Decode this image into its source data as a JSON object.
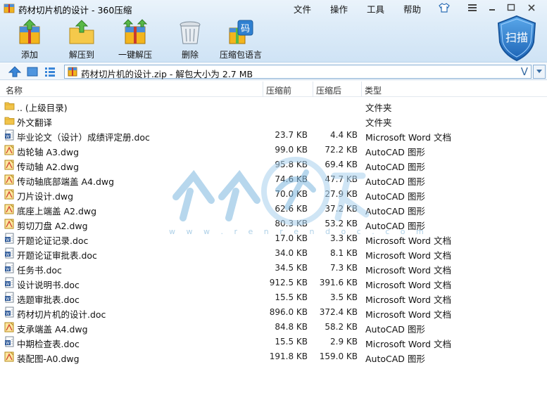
{
  "window": {
    "title": "药材切片机的设计 - 360压缩",
    "menu": [
      "文件",
      "操作",
      "工具",
      "帮助"
    ]
  },
  "toolbar": {
    "add": "添加",
    "extract_to": "解压到",
    "one_click_extract": "一键解压",
    "delete": "删除",
    "encoding": "压缩包语言",
    "scan": "扫描",
    "encoding_icon_char": "码"
  },
  "address": {
    "path": "药材切片机的设计.zip - 解包大小为 2.7 MB",
    "v_char": "V"
  },
  "columns": {
    "name": "名称",
    "compressed_before": "压缩前",
    "compressed_after": "压缩后",
    "type": "类型"
  },
  "files": [
    {
      "name": ".. (上级目录)",
      "before": "",
      "after": "",
      "type": "文件夹",
      "icon": "folder-icon"
    },
    {
      "name": "外文翻译",
      "before": "",
      "after": "",
      "type": "文件夹",
      "icon": "folder-icon"
    },
    {
      "name": "毕业论文（设计）成绩评定册.doc",
      "before": "23.7 KB",
      "after": "4.4 KB",
      "type": "Microsoft Word 文档",
      "icon": "word-doc-icon"
    },
    {
      "name": "齿轮轴 A3.dwg",
      "before": "99.0 KB",
      "after": "72.2 KB",
      "type": "AutoCAD 图形",
      "icon": "autocad-icon"
    },
    {
      "name": "传动轴 A2.dwg",
      "before": "95.8 KB",
      "after": "69.4 KB",
      "type": "AutoCAD 图形",
      "icon": "autocad-icon"
    },
    {
      "name": "传动轴底部端盖 A4.dwg",
      "before": "74.6 KB",
      "after": "47.7 KB",
      "type": "AutoCAD 图形",
      "icon": "autocad-icon"
    },
    {
      "name": "刀片设计.dwg",
      "before": "70.0 KB",
      "after": "27.9 KB",
      "type": "AutoCAD 图形",
      "icon": "autocad-icon"
    },
    {
      "name": "底座上端盖 A2.dwg",
      "before": "62.6 KB",
      "after": "37.2 KB",
      "type": "AutoCAD 图形",
      "icon": "autocad-icon"
    },
    {
      "name": "剪切刀盘 A2.dwg",
      "before": "80.3 KB",
      "after": "53.2 KB",
      "type": "AutoCAD 图形",
      "icon": "autocad-icon"
    },
    {
      "name": "开题论证记录.doc",
      "before": "17.0 KB",
      "after": "3.3 KB",
      "type": "Microsoft Word 文档",
      "icon": "word-doc-icon"
    },
    {
      "name": "开题论证审批表.doc",
      "before": "34.0 KB",
      "after": "8.1 KB",
      "type": "Microsoft Word 文档",
      "icon": "word-doc-icon"
    },
    {
      "name": "任务书.doc",
      "before": "34.5 KB",
      "after": "7.3 KB",
      "type": "Microsoft Word 文档",
      "icon": "word-doc-icon"
    },
    {
      "name": "设计说明书.doc",
      "before": "912.5 KB",
      "after": "391.6 KB",
      "type": "Microsoft Word 文档",
      "icon": "word-doc-icon"
    },
    {
      "name": "选题审批表.doc",
      "before": "15.5 KB",
      "after": "3.5 KB",
      "type": "Microsoft Word 文档",
      "icon": "word-doc-icon"
    },
    {
      "name": "药材切片机的设计.doc",
      "before": "896.0 KB",
      "after": "372.4 KB",
      "type": "Microsoft Word 文档",
      "icon": "word-doc-icon"
    },
    {
      "name": "支承端盖 A4.dwg",
      "before": "84.8 KB",
      "after": "58.2 KB",
      "type": "AutoCAD 图形",
      "icon": "autocad-icon"
    },
    {
      "name": "中期检查表.doc",
      "before": "15.5 KB",
      "after": "2.9 KB",
      "type": "Microsoft Word 文档",
      "icon": "word-doc-icon"
    },
    {
      "name": "装配图-A0.dwg",
      "before": "191.8 KB",
      "after": "159.0 KB",
      "type": "AutoCAD 图形",
      "icon": "autocad-icon"
    }
  ],
  "watermark": {
    "text": "w w w . r e n r e n d o c . c o m"
  },
  "colors": {
    "accent_blue": "#2b6db5",
    "scan_badge": "#2a7fd0",
    "folder": "#f2c44a"
  }
}
